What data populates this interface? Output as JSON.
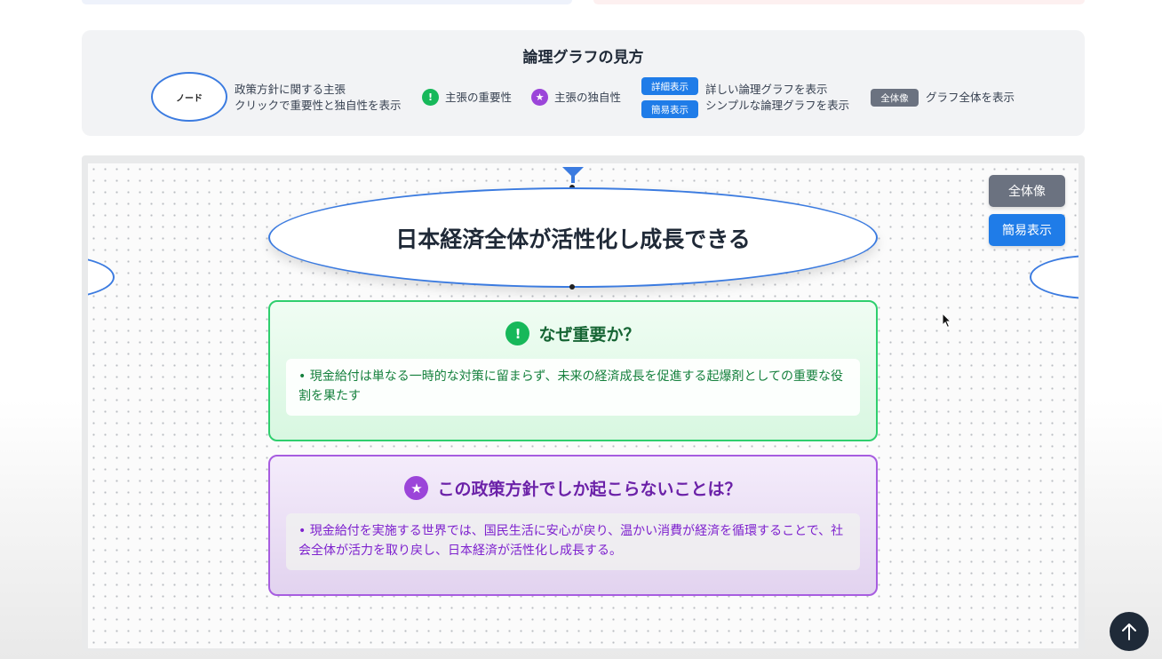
{
  "legend": {
    "title": "論理グラフの見方",
    "node_label": "ノード",
    "node_desc_1": "政策方針に関する主張",
    "node_desc_2": "クリックで重要性と独自性を表示",
    "importance_icon": "!",
    "importance_label": "主張の重要性",
    "uniqueness_icon": "★",
    "uniqueness_label": "主張の独自性",
    "detail_btn": "詳細表示",
    "simple_btn": "簡易表示",
    "detail_desc": "詳しい論理グラフを表示",
    "simple_desc": "シンプルな論理グラフを表示",
    "overview_btn": "全体像",
    "overview_desc": "グラフ全体を表示"
  },
  "graph": {
    "main_node": "日本経済全体が活性化し成長できる",
    "importance": {
      "icon": "!",
      "heading": "なぜ重要か？",
      "text": "• 現金給付は単なる一時的な対策に留まらず、未来の経済成長を促進する起爆剤としての重要な役割を果たす"
    },
    "uniqueness": {
      "icon": "★",
      "heading": "この政策方針でしか起こらないことは？",
      "text": "• 現金給付を実施する世界では、国民生活に安心が戻り、温かい消費が経済を循環することで、社会全体が活力を取り戻し、日本経済が活性化し成長する。"
    }
  },
  "controls": {
    "overview_button": "全体像",
    "simple_button": "簡易表示"
  },
  "icons": {
    "scroll_top": "arrow-up-icon",
    "cursor": "mouse-pointer-icon"
  },
  "colors": {
    "node_border": "#3b7be0",
    "importance_green": "#17b85a",
    "uniqueness_purple": "#9b45d9",
    "button_blue": "#1f7ce8",
    "button_gray": "#6b7280"
  }
}
